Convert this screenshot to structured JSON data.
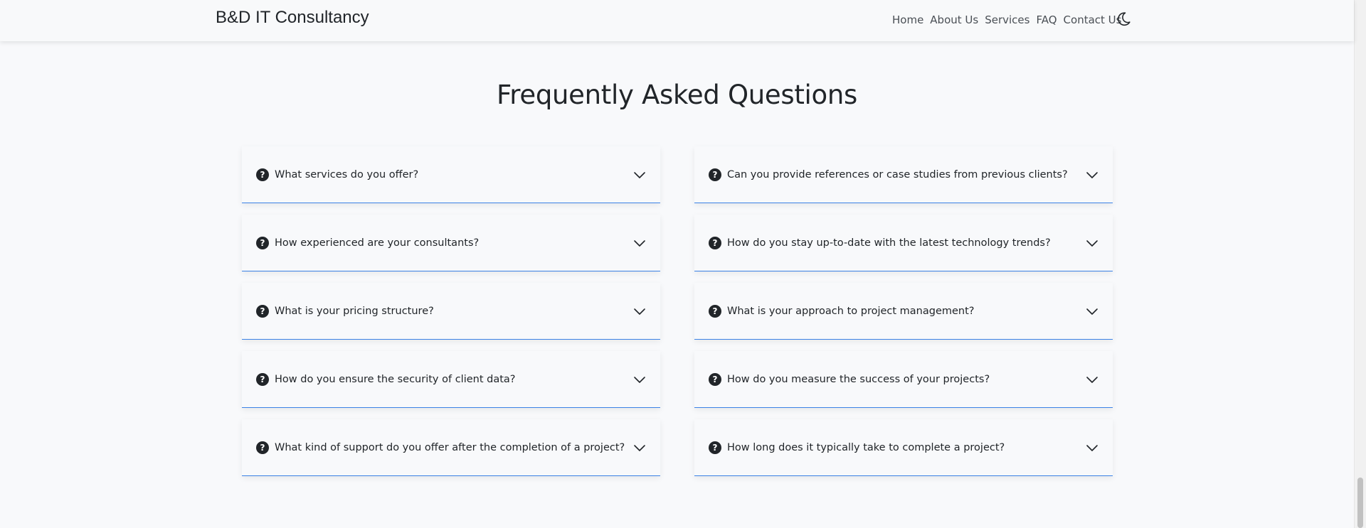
{
  "navbar": {
    "brand": "B&D IT Consultancy",
    "links": [
      "Home",
      "About Us",
      "Services",
      "FAQ",
      "Contact Us"
    ],
    "theme_icon": "moon-icon"
  },
  "faq": {
    "title": "Frequently Asked Questions",
    "left": [
      "What services do you offer?",
      "How experienced are your consultants?",
      "What is your pricing structure?",
      "How do you ensure the security of client data?",
      "What kind of support do you offer after the completion of a project?"
    ],
    "right": [
      "Can you provide references or case studies from previous clients?",
      "How do you stay up-to-date with the latest technology trends?",
      "What is your approach to project management?",
      "How do you measure the success of your projects?",
      "How long does it typically take to complete a project?"
    ],
    "question_icon_glyph": "?",
    "accent_color": "#3b82e6"
  }
}
